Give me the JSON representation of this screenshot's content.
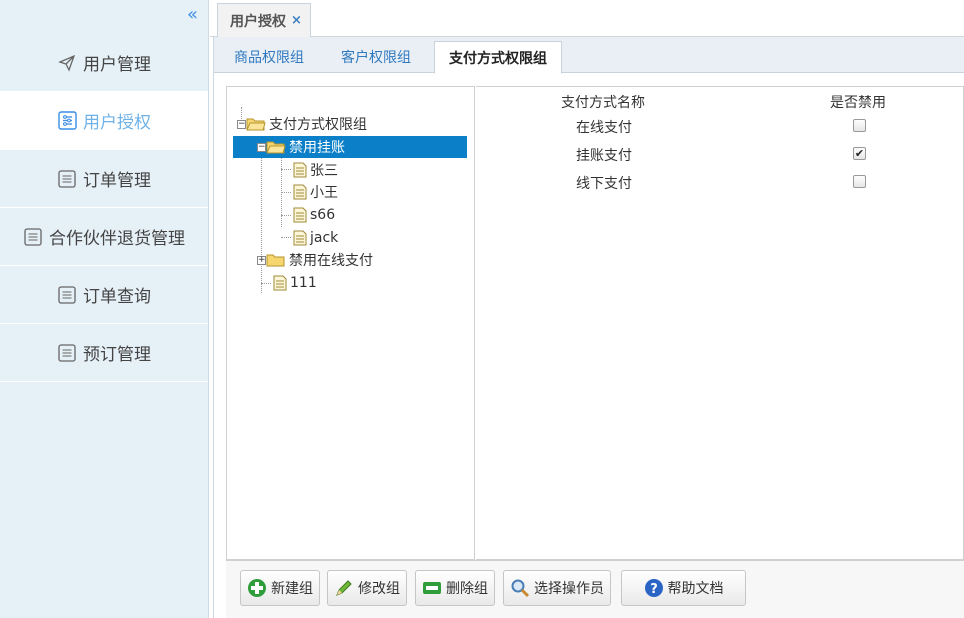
{
  "sidebar": {
    "items": [
      {
        "label": "用户管理",
        "icon": "paper-plane-icon"
      },
      {
        "label": "用户授权",
        "icon": "settings-list-icon",
        "active": true
      },
      {
        "label": "订单管理",
        "icon": "list-icon"
      },
      {
        "label": "合作伙伴退货管理",
        "icon": "list-icon"
      },
      {
        "label": "订单查询",
        "icon": "list-icon"
      },
      {
        "label": "预订管理",
        "icon": "list-icon"
      }
    ]
  },
  "page_tab": {
    "label": "用户授权",
    "close": "×"
  },
  "sub_tabs": [
    "商品权限组",
    "客户权限组",
    "支付方式权限组"
  ],
  "tree": {
    "root": "支付方式权限组",
    "group1": "禁用挂账",
    "children": [
      "张三",
      "小王",
      "s66",
      "jack"
    ],
    "group2": "禁用在线支付",
    "leaf": "111"
  },
  "grid": {
    "headers": [
      "支付方式名称",
      "是否禁用"
    ],
    "rows": [
      {
        "name": "在线支付",
        "disabled": false
      },
      {
        "name": "挂账支付",
        "disabled": true
      },
      {
        "name": "线下支付",
        "disabled": false
      }
    ]
  },
  "toolbar": {
    "new_group": "新建组",
    "edit_group": "修改组",
    "delete_group": "删除组",
    "select_operator": "选择操作员",
    "help": "帮助文档"
  },
  "colors": {
    "accent": "#0b7fc7",
    "sidebar_bg": "#e6f0f7",
    "active_text": "#6fb2e8"
  }
}
